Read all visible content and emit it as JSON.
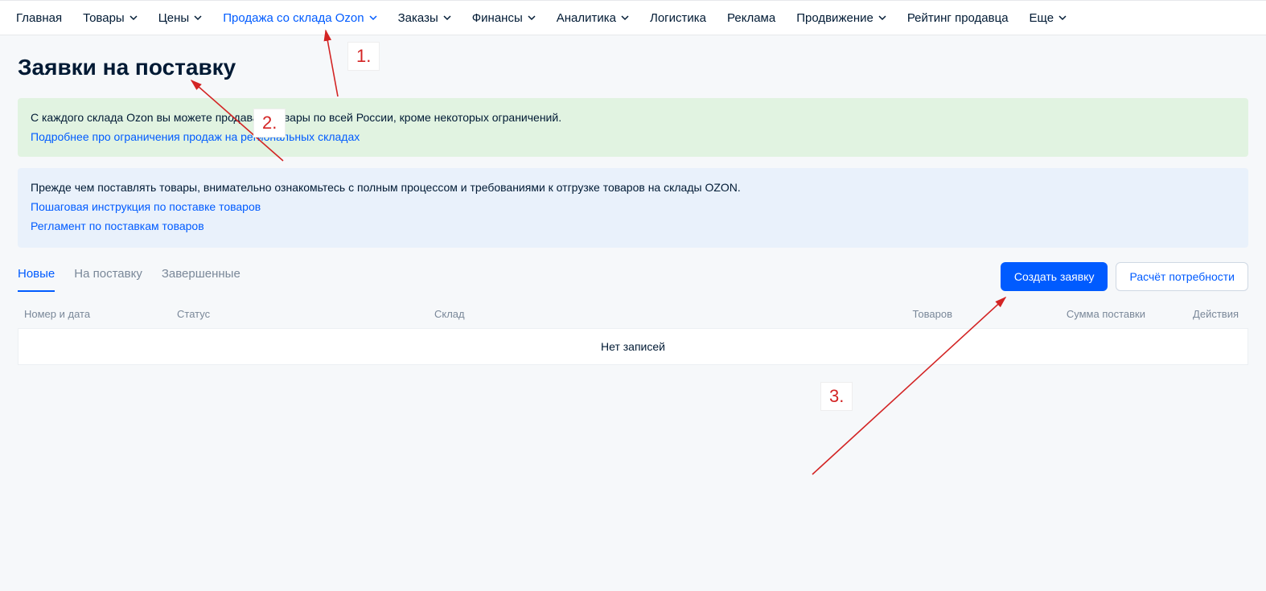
{
  "nav": [
    {
      "label": "Главная",
      "dropdown": false
    },
    {
      "label": "Товары",
      "dropdown": true
    },
    {
      "label": "Цены",
      "dropdown": true
    },
    {
      "label": "Продажа со склада Ozon",
      "dropdown": true,
      "active": true
    },
    {
      "label": "Заказы",
      "dropdown": true
    },
    {
      "label": "Финансы",
      "dropdown": true
    },
    {
      "label": "Аналитика",
      "dropdown": true
    },
    {
      "label": "Логистика",
      "dropdown": false
    },
    {
      "label": "Реклама",
      "dropdown": false
    },
    {
      "label": "Продвижение",
      "dropdown": true
    },
    {
      "label": "Рейтинг продавца",
      "dropdown": false
    },
    {
      "label": "Еще",
      "dropdown": true
    }
  ],
  "page_title": "Заявки на поставку",
  "alert_green": {
    "text": "С каждого склада Ozon вы можете продавать товары по всей России, кроме некоторых ограничений.",
    "link": "Подробнее про ограничения продаж на региональных складах"
  },
  "alert_blue": {
    "text": "Прежде чем поставлять товары, внимательно ознакомьтесь с полным процессом и требованиями к отгрузке товаров на склады OZON.",
    "link1": "Пошаговая инструкция по поставке товаров",
    "link2": "Регламент по поставкам товаров"
  },
  "tabs": [
    {
      "label": "Новые",
      "active": true
    },
    {
      "label": "На поставку"
    },
    {
      "label": "Завершенные"
    }
  ],
  "actions": {
    "create": "Создать заявку",
    "calc": "Расчёт потребности"
  },
  "table": {
    "headers": {
      "num": "Номер и дата",
      "status": "Статус",
      "warehouse": "Склад",
      "goods": "Товаров",
      "sum": "Сумма поставки",
      "actions": "Действия"
    },
    "empty": "Нет записей"
  },
  "annotations": {
    "l1": "1.",
    "l2": "2.",
    "l3": "3."
  }
}
